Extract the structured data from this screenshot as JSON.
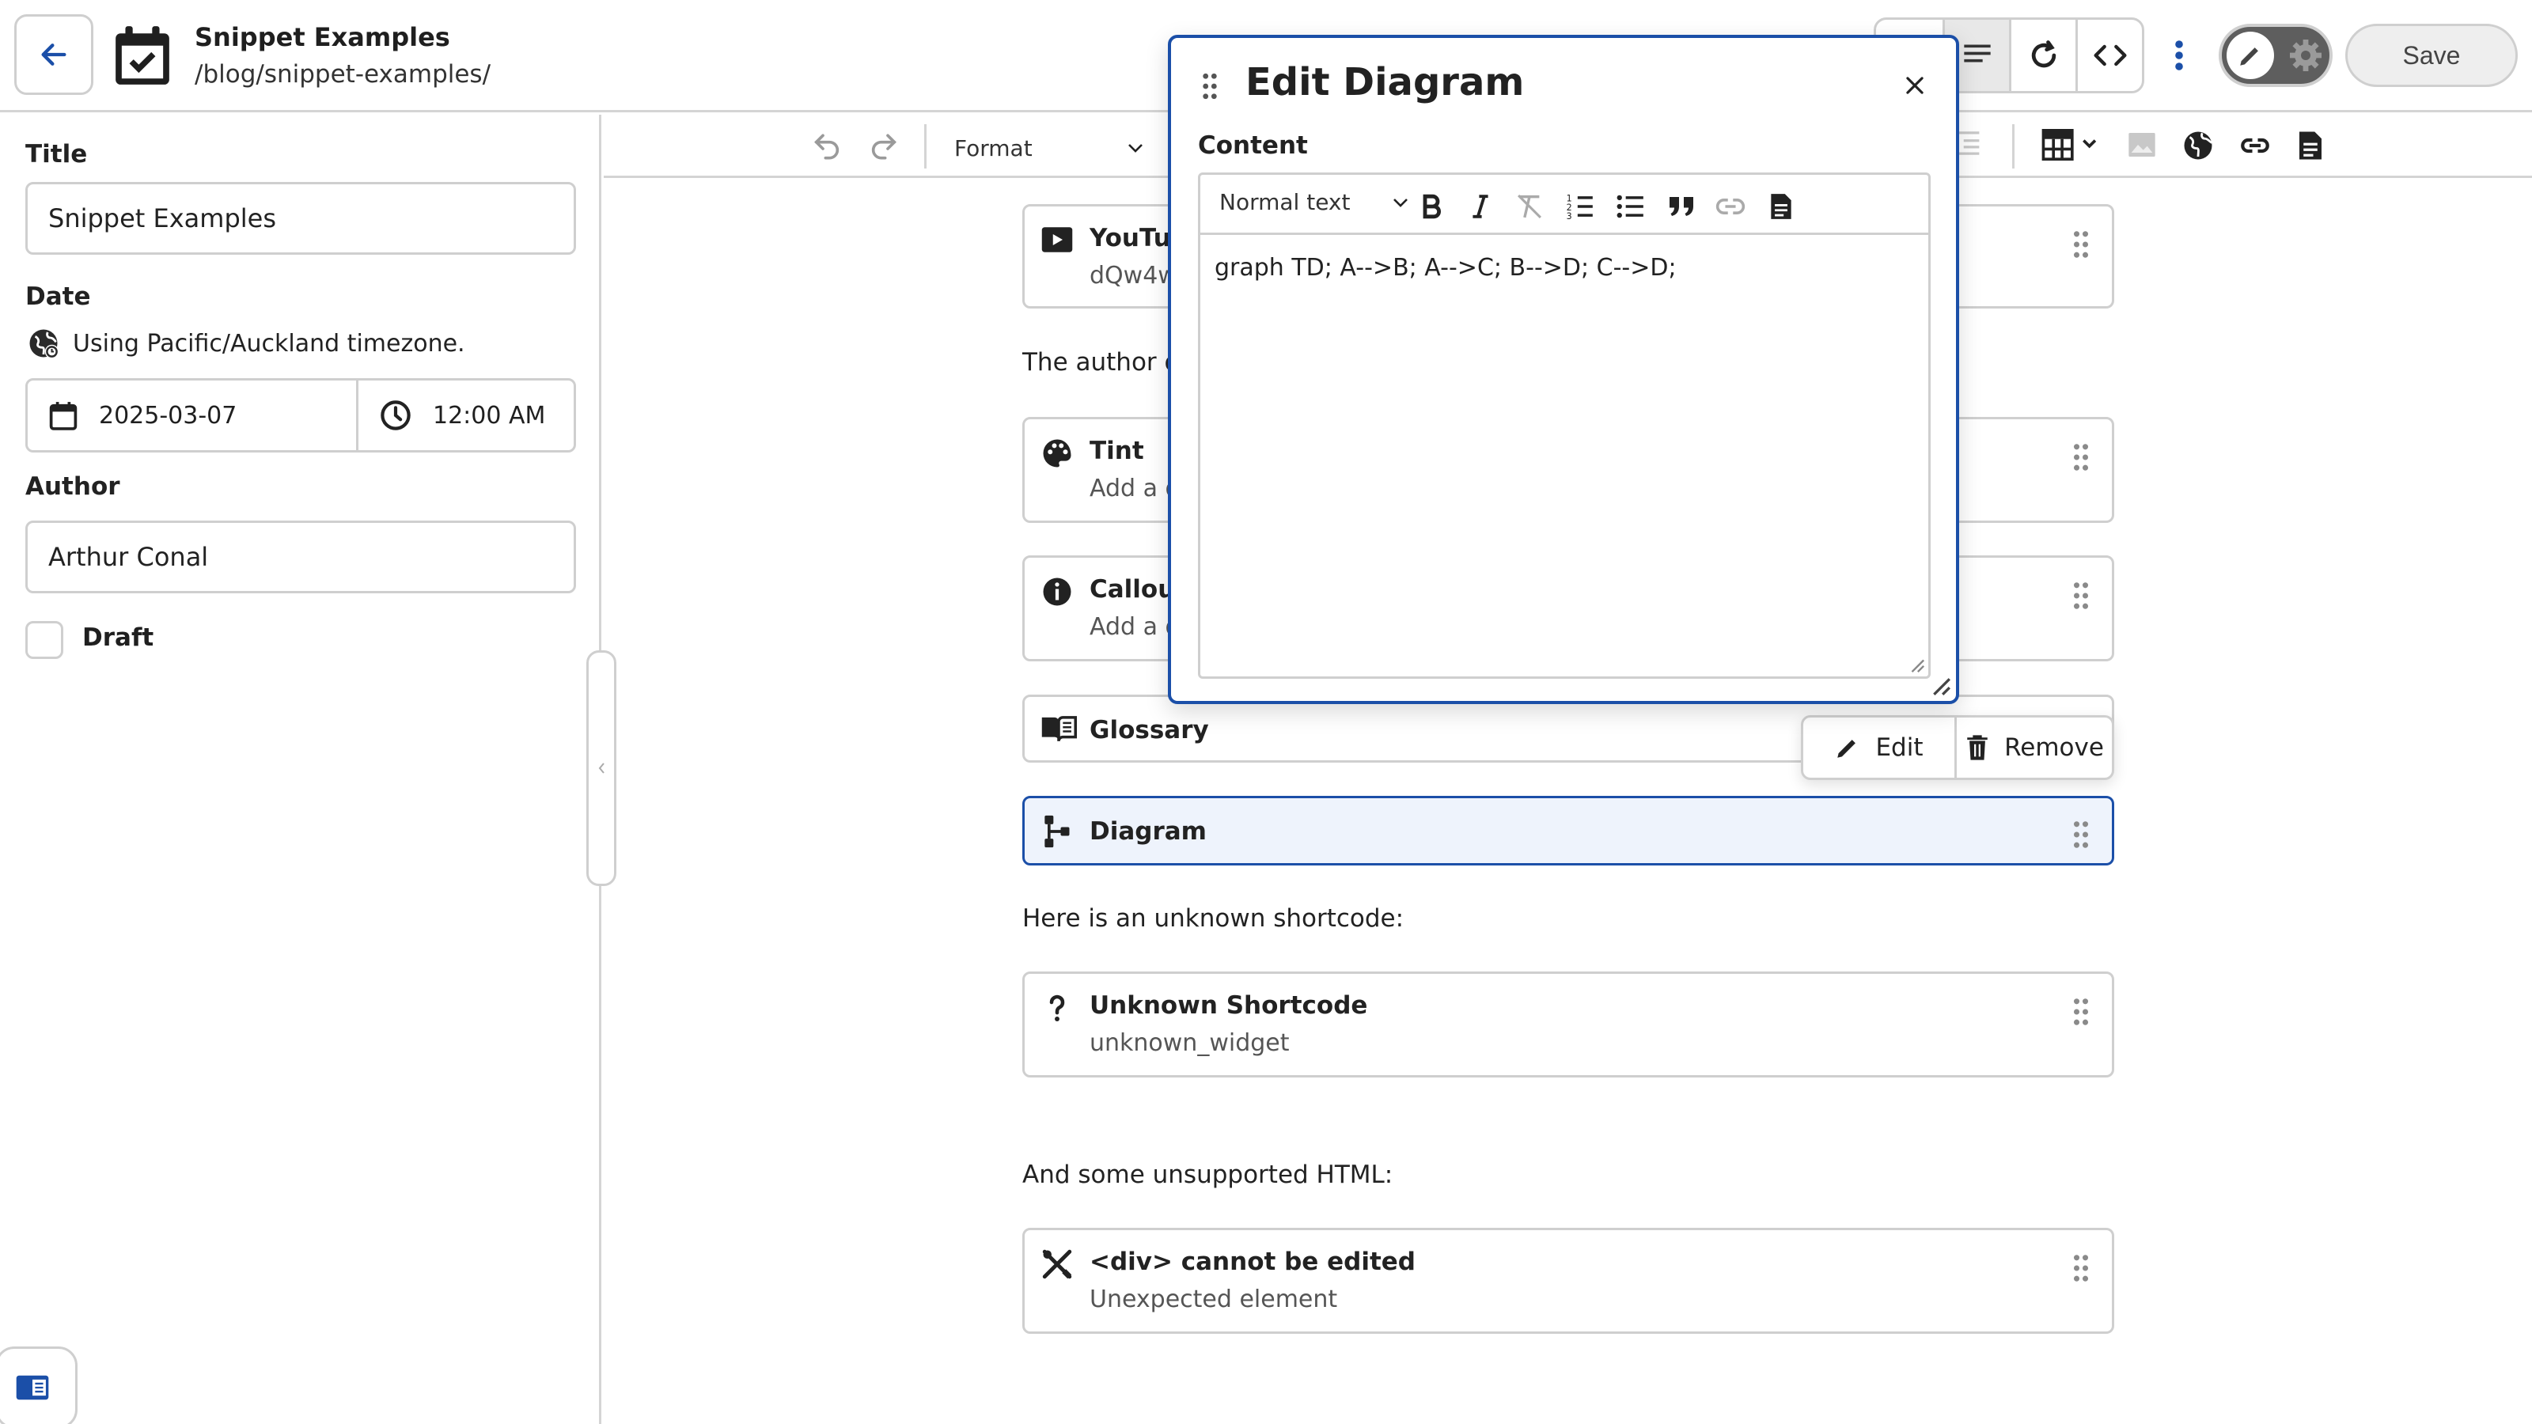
{
  "header": {
    "title": "Snippet Examples",
    "path": "/blog/snippet-examples/",
    "save_label": "Save"
  },
  "sidebar": {
    "title_label": "Title",
    "title_value": "Snippet Examples",
    "date_label": "Date",
    "timezone_note": "Using Pacific/Auckland timezone.",
    "date_value": "2025-03-07",
    "time_value": "12:00 AM",
    "author_label": "Author",
    "author_value": "Arthur Conal",
    "draft_label": "Draft"
  },
  "toolbar": {
    "format_label": "Format"
  },
  "content": {
    "blocks": [
      {
        "title": "YouTube",
        "subtitle": "dQw4w9WgXcQ",
        "icon": "youtube-icon"
      },
      {
        "title": "Tint",
        "subtitle": "Add a description",
        "icon": "palette-icon"
      },
      {
        "title": "Callout",
        "subtitle": "Add a description",
        "icon": "info-icon"
      },
      {
        "title": "Glossary",
        "icon": "book-icon"
      },
      {
        "title": "Diagram",
        "icon": "diagram-icon"
      },
      {
        "title": "Unknown Shortcode",
        "subtitle": "unknown_widget",
        "icon": "question-icon"
      },
      {
        "title": "<div> cannot be edited",
        "subtitle": "Unexpected element",
        "icon": "tools-off-icon"
      }
    ],
    "para_author": "The author of this post.",
    "para_unknown": "Here is an unknown shortcode:",
    "para_html": "And some unsupported HTML:",
    "edit_label": "Edit",
    "remove_label": "Remove"
  },
  "dialog": {
    "title": "Edit Diagram",
    "content_label": "Content",
    "text_style": "Normal text",
    "content_value": "graph TD; A-->B; A-->C; B-->D; C-->D;"
  },
  "colors": {
    "accent": "#1b4fa8",
    "selected_bg": "#eef3fc",
    "border": "#cfcfcf"
  }
}
